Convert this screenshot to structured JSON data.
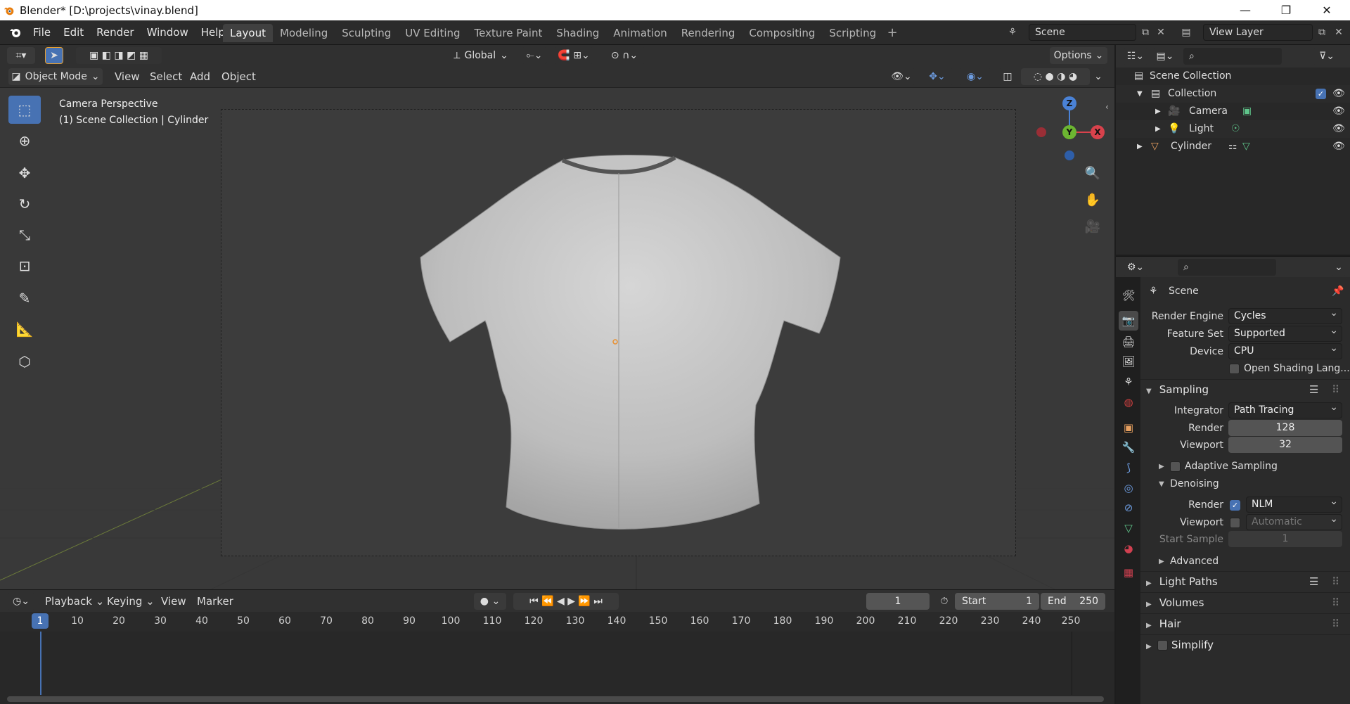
{
  "window": {
    "title": "Blender* [D:\\projects\\vinay.blend]",
    "minimize": "—",
    "maximize": "❐",
    "close": "✕"
  },
  "menu": [
    "File",
    "Edit",
    "Render",
    "Window",
    "Help"
  ],
  "workspaces": [
    "Layout",
    "Modeling",
    "Sculpting",
    "UV Editing",
    "Texture Paint",
    "Shading",
    "Animation",
    "Rendering",
    "Compositing",
    "Scripting"
  ],
  "active_workspace": "Layout",
  "add_workspace": "+",
  "scene_name": "Scene",
  "view_layer": "View Layer",
  "viewport_header": {
    "transform_orientation": "Global",
    "options": "Options",
    "mode": "Object Mode",
    "menus": [
      "View",
      "Select",
      "Add",
      "Object"
    ]
  },
  "viewport_info": {
    "line1": "Camera Perspective",
    "line2": "(1) Scene Collection | Cylinder"
  },
  "gizmo": {
    "z": "Z",
    "y": "Y",
    "x": "X"
  },
  "timeline": {
    "menus": [
      "Playback",
      "Keying",
      "View",
      "Marker"
    ],
    "current_frame": "1",
    "start_label": "Start",
    "start_value": "1",
    "end_label": "End",
    "end_value": "250",
    "ticks": [
      "1",
      "10",
      "20",
      "30",
      "40",
      "50",
      "60",
      "70",
      "80",
      "90",
      "100",
      "110",
      "120",
      "130",
      "140",
      "150",
      "160",
      "170",
      "180",
      "190",
      "200",
      "210",
      "220",
      "230",
      "240",
      "250"
    ]
  },
  "outliner": {
    "root": "Scene Collection",
    "collection": "Collection",
    "items": [
      "Camera",
      "Light",
      "Cylinder"
    ]
  },
  "properties": {
    "context": "Scene",
    "render_engine_label": "Render Engine",
    "render_engine": "Cycles",
    "feature_set_label": "Feature Set",
    "feature_set": "Supported",
    "device_label": "Device",
    "device": "CPU",
    "osl_label": "Open Shading Lang...",
    "sampling": {
      "title": "Sampling",
      "integrator_label": "Integrator",
      "integrator": "Path Tracing",
      "render_label": "Render",
      "render_samples": "128",
      "viewport_label": "Viewport",
      "viewport_samples": "32",
      "adaptive": "Adaptive Sampling",
      "denoising": "Denoising",
      "den_render_label": "Render",
      "den_render": "NLM",
      "den_viewport_label": "Viewport",
      "den_viewport": "Automatic",
      "start_sample_label": "Start Sample",
      "start_sample": "1",
      "advanced": "Advanced"
    },
    "panels": [
      "Light Paths",
      "Volumes",
      "Hair",
      "Simplify"
    ]
  }
}
